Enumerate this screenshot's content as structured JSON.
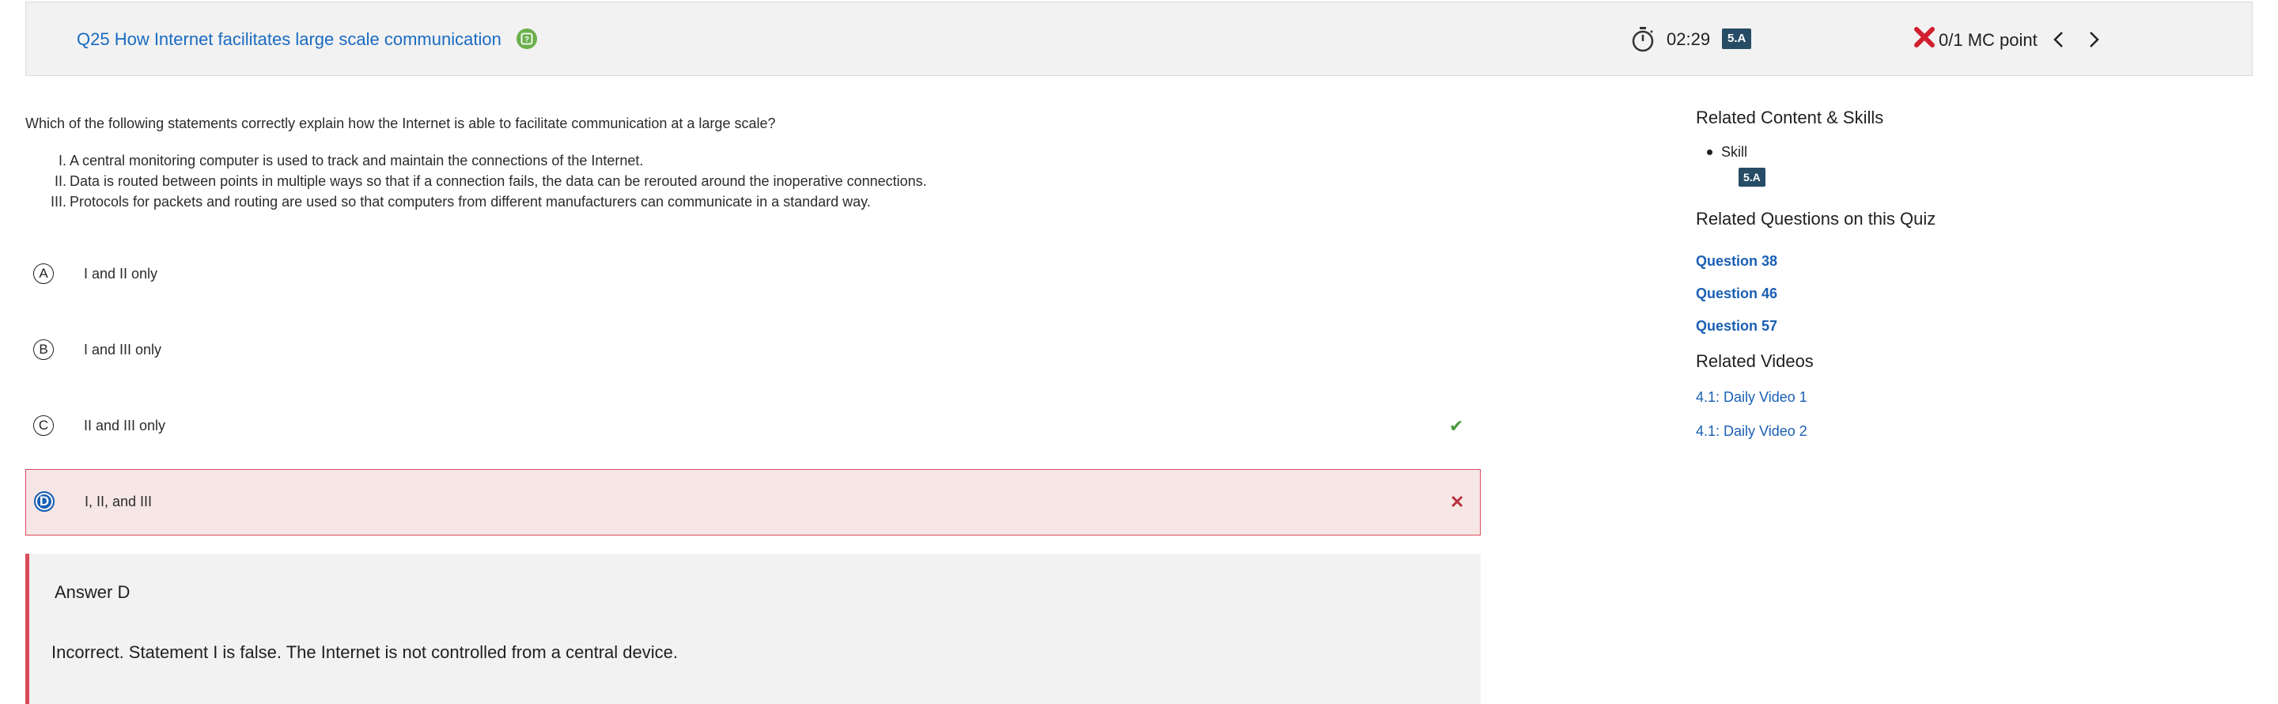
{
  "header": {
    "question_title": "Q25 How Internet facilitates large scale communication",
    "help_icon": "question-icon",
    "timer": "02:29",
    "skill_badge": "5.A",
    "score": "0/1 MC point",
    "status_icon": "red-x-icon",
    "colors": {
      "title": "#1a6bc1",
      "help": "#6ab04c",
      "badge": "#264c66",
      "error": "#d21f2f"
    }
  },
  "question": {
    "prompt": "Which of the following statements correctly explain how the Internet is able to facilitate communication at a large scale?",
    "statements": [
      {
        "num": "I.",
        "text": "A central monitoring computer is used to track and maintain the connections of the Internet."
      },
      {
        "num": "II.",
        "text": "Data is routed between points in multiple ways so that if a connection fails, the data can be rerouted around the inoperative connections."
      },
      {
        "num": "III.",
        "text": "Protocols for packets and routing are used so that computers from different manufacturers can communicate in a standard way."
      }
    ]
  },
  "options": [
    {
      "letter": "A",
      "text": "I and II only",
      "state": "none"
    },
    {
      "letter": "B",
      "text": "I and III only",
      "state": "none"
    },
    {
      "letter": "C",
      "text": "II and III only",
      "state": "correct",
      "mark": "✔"
    },
    {
      "letter": "D",
      "text": "I, II, and III",
      "state": "selected-incorrect",
      "mark": "✕"
    }
  ],
  "feedback": {
    "title": "Answer D",
    "text": "Incorrect. Statement I is false. The Internet is not controlled from a central device."
  },
  "sidebar": {
    "content_heading": "Related Content & Skills",
    "skill_label": "Skill",
    "skill_badge": "5.A",
    "questions_heading": "Related Questions on this Quiz",
    "questions": [
      "Question 38",
      "Question 46",
      "Question 57"
    ],
    "videos_heading": "Related Videos",
    "videos": [
      "4.1: Daily Video 1",
      "4.1: Daily Video 2"
    ]
  }
}
